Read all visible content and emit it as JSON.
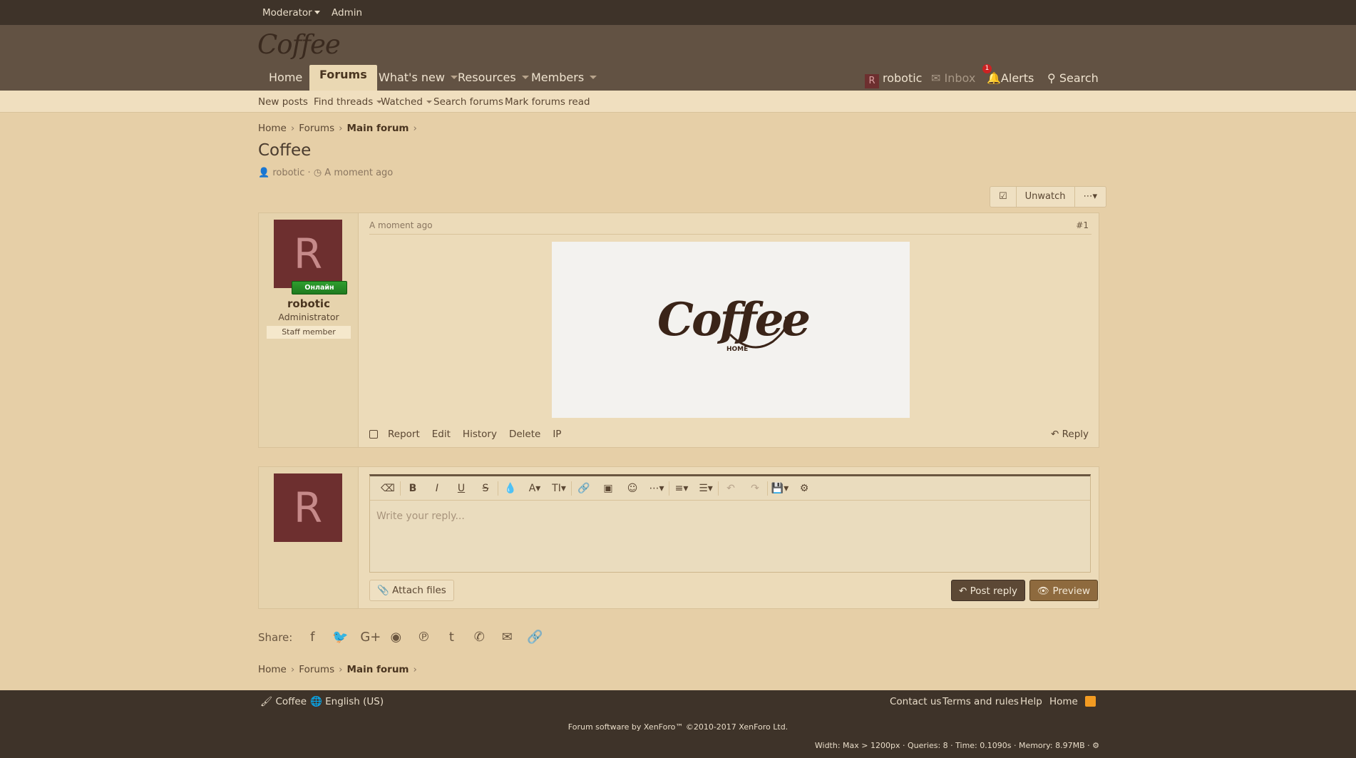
{
  "adminbar": {
    "moderator": "Moderator",
    "admin": "Admin"
  },
  "header": {
    "logo": "Coffee",
    "nav": {
      "home": "Home",
      "forums": "Forums",
      "whats_new": "What's new",
      "resources": "Resources",
      "members": "Members"
    },
    "user": {
      "initial": "R",
      "name": "robotic",
      "inbox": "Inbox",
      "alerts": "Alerts",
      "alerts_count": "1",
      "search": "Search"
    }
  },
  "subnav": {
    "new_posts": "New posts",
    "find_threads": "Find threads",
    "watched": "Watched",
    "search_forums": "Search forums",
    "mark_read": "Mark forums read"
  },
  "breadcrumb": {
    "home": "Home",
    "forums": "Forums",
    "main": "Main forum"
  },
  "thread": {
    "title": "Coffee",
    "author": "robotic",
    "time": "A moment ago",
    "unwatch": "Unwatch"
  },
  "post": {
    "date": "A moment ago",
    "number": "#1",
    "avatar_initial": "R",
    "online": "Онлайн",
    "username": "robotic",
    "user_title": "Administrator",
    "banner": "Staff member",
    "image_logo": "Coffee",
    "image_sub": "HOME",
    "actions": {
      "report": "Report",
      "edit": "Edit",
      "history": "History",
      "delete": "Delete",
      "ip": "IP",
      "reply": "Reply"
    }
  },
  "reply": {
    "avatar_initial": "R",
    "placeholder": "Write your reply...",
    "attach": "Attach files",
    "post_reply": "Post reply",
    "preview": "Preview"
  },
  "share": {
    "label": "Share:"
  },
  "footer": {
    "style": "Coffee",
    "language": "English (US)",
    "contact": "Contact us",
    "terms": "Terms and rules",
    "help": "Help",
    "home": "Home",
    "copyright": "Forum software by XenForo™ ©2010-2017 XenForo Ltd.",
    "debug": "Width: Max > 1200px · Queries: 8 · Time: 0.1090s · Memory: 8.97MB ·"
  }
}
